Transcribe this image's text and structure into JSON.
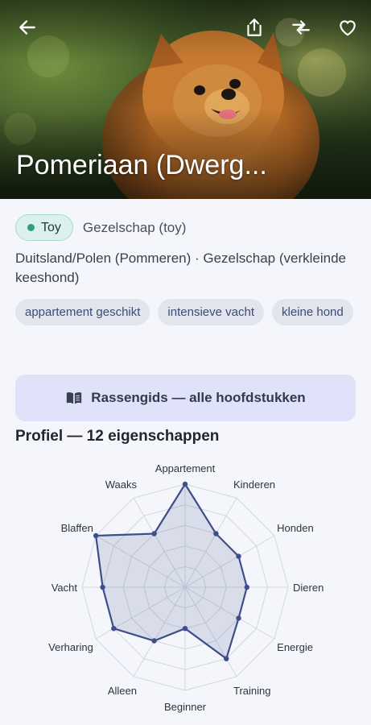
{
  "header": {
    "title": "Pomeriaan (Dwerg...",
    "back_icon": "arrow-left-icon",
    "share_icon": "share-icon",
    "compare_icon": "compare-icon",
    "favorite_icon": "heart-icon"
  },
  "group": {
    "chip_label": "Toy",
    "chip_color": "#2f9e85",
    "text": "Gezelschap (toy)"
  },
  "origin_text": "Duitsland/Polen (Pommeren) · Gezelschap (verkleinde keeshond)",
  "tags": [
    "appartement geschikt",
    "intensieve vacht",
    "kleine hond"
  ],
  "guide_button": {
    "label": "Rassengids — alle hoofdstukken",
    "icon": "book-open-icon"
  },
  "profile": {
    "title": "Profiel — 12 eigenschappen"
  },
  "chart_data": {
    "type": "radar",
    "categories": [
      "Appartement",
      "Kinderen",
      "Honden",
      "Dieren",
      "Energie",
      "Training",
      "Beginner",
      "Alleen",
      "Verharing",
      "Vacht",
      "Blaffen",
      "Waaks"
    ],
    "series": [
      {
        "values": [
          5,
          3,
          3,
          3,
          3,
          4,
          2,
          3,
          4,
          4,
          5,
          3
        ]
      }
    ],
    "range": [
      0,
      5
    ],
    "rings": 5,
    "color": "#3d4e8a",
    "fill": "rgba(61,78,138,0.15)"
  }
}
